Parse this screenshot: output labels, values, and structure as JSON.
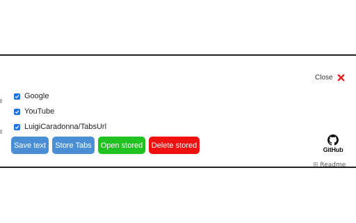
{
  "close": {
    "label": "Close"
  },
  "items": [
    {
      "label": "Google",
      "checked": true
    },
    {
      "label": "YouTube",
      "checked": true
    },
    {
      "label": "LuigiCaradonna/TabsUrl",
      "checked": true
    }
  ],
  "buttons": {
    "save_text": {
      "label": "Save text",
      "color": "#4a8fd6"
    },
    "store_tabs": {
      "label": "Store Tabs",
      "color": "#4a8fd6"
    },
    "open_stored": {
      "label": "Open stored",
      "color": "#1fc21f"
    },
    "delete_stored": {
      "label": "Delete stored",
      "color": "#f01010"
    }
  },
  "github": {
    "label": "GitHub",
    "icon": "github-icon"
  },
  "background": {
    "peek_text": "Readme"
  },
  "colors": {
    "close_x": "#e11b1b",
    "checkbox": "#1a73e8"
  }
}
